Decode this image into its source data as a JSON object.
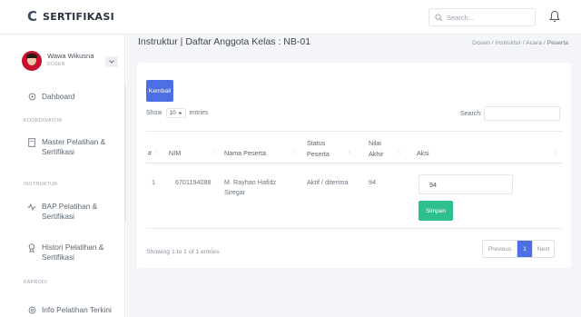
{
  "brand": {
    "logo": "C",
    "name": "SERTIFIKASI"
  },
  "header": {
    "search_placeholder": "Search..."
  },
  "user": {
    "name": "Wawa Wikusna",
    "role": "DOSEN"
  },
  "sidebar": {
    "dashboard": "Dahboard",
    "koordinator_heading": "KOORDINATOR",
    "master": [
      "Master Pelatihan &",
      "Sertifikasi"
    ],
    "instruktur_heading": "INSTRUKTUR",
    "bap": [
      "BAP Pelatihan &",
      "Sertifikasi"
    ],
    "histori": [
      "Histori Pelatihan &",
      "Sertifikasi"
    ],
    "kaprodi_heading": "KAPRODI",
    "info": "Info Pelatihan Terkini"
  },
  "page": {
    "title": "Instruktur | Daftar Anggota Kelas : NB-01",
    "breadcrumb": [
      "Dosen",
      "Instruktur",
      "Acara",
      "Peserta"
    ]
  },
  "card": {
    "back_label": "Kembali",
    "show_label": "Show",
    "entries_value": "10",
    "entries_label": "entries",
    "search_label": "Search:",
    "columns": {
      "no": "#",
      "nim": "NIM",
      "nama": "Nama Peserta",
      "status": [
        "Status",
        "Peserta"
      ],
      "nilai": [
        "Nilai",
        "Akhir"
      ],
      "aksi": "Aksi"
    },
    "rows": [
      {
        "no": "1",
        "nim": "6701194088",
        "nama": [
          "M. Rayhan Hafidz",
          "Siregar"
        ],
        "status": "Aktif / diterima",
        "nilai": "94",
        "input_value": "94"
      }
    ],
    "save_label": "Simpan",
    "footer_info": "Showing 1 to 1 of 1 entries",
    "pager": {
      "previous": "Previous",
      "current": "1",
      "next": "Next"
    }
  },
  "colors": {
    "primary": "#4e6ee6",
    "success": "#2ebf8f",
    "avatar": "#c8102e"
  }
}
